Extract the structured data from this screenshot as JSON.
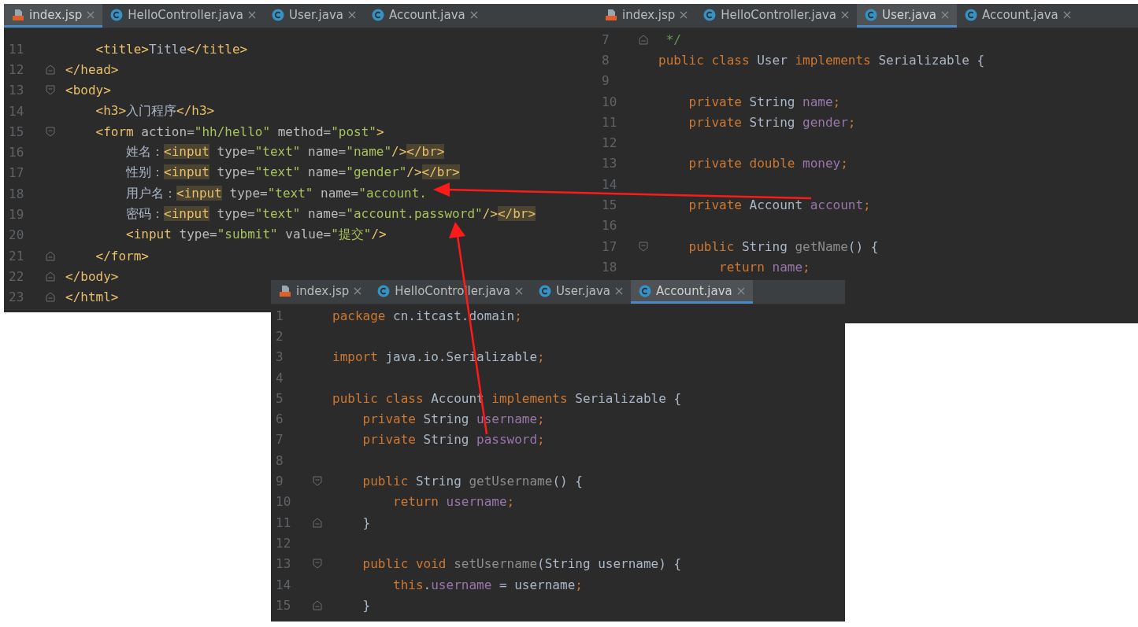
{
  "windows": [
    {
      "tabs": [
        {
          "label": "index.jsp",
          "kind": "jsp",
          "selected": true
        },
        {
          "label": "HelloController.java",
          "kind": "class",
          "selected": false
        },
        {
          "label": "User.java",
          "kind": "class",
          "selected": false
        },
        {
          "label": "Account.java",
          "kind": "class",
          "selected": false
        }
      ],
      "lines": [
        {
          "number": "11",
          "kind": "code",
          "tokens": [
            {
              "text": "    <title>",
              "kind": "tag"
            },
            {
              "text": "Title",
              "kind": "plain"
            },
            {
              "text": "</title>",
              "kind": "tag"
            }
          ]
        },
        {
          "number": "12",
          "kind": "fold-end",
          "tokens": [
            {
              "text": "</head>",
              "kind": "tag"
            }
          ]
        },
        {
          "number": "13",
          "kind": "fold-start",
          "tokens": [
            {
              "text": "<body>",
              "kind": "tag"
            }
          ]
        },
        {
          "number": "14",
          "kind": "code",
          "tokens": [
            {
              "text": "    <h3>",
              "kind": "tag"
            },
            {
              "text": "入门程序",
              "kind": "plain"
            },
            {
              "text": "</h3>",
              "kind": "tag"
            }
          ]
        },
        {
          "number": "15",
          "kind": "fold-start",
          "tokens": [
            {
              "text": "    <form ",
              "kind": "tag"
            },
            {
              "text": "action=",
              "kind": "attr"
            },
            {
              "text": "\"hh/hello\"",
              "kind": "str"
            },
            {
              "text": " method=",
              "kind": "attr"
            },
            {
              "text": "\"post\"",
              "kind": "str"
            },
            {
              "text": ">",
              "kind": "tag"
            }
          ]
        },
        {
          "number": "16",
          "kind": "code",
          "tokens": [
            {
              "text": "        姓名：",
              "kind": "plain"
            },
            {
              "text": "<input",
              "kind": "taghl"
            },
            {
              "text": " type=",
              "kind": "attr"
            },
            {
              "text": "\"text\"",
              "kind": "str"
            },
            {
              "text": " name=",
              "kind": "attr"
            },
            {
              "text": "\"name\"",
              "kind": "str"
            },
            {
              "text": "/>",
              "kind": "tag"
            },
            {
              "text": "</br>",
              "kind": "taghl"
            }
          ]
        },
        {
          "number": "17",
          "kind": "code",
          "tokens": [
            {
              "text": "        性别：",
              "kind": "plain"
            },
            {
              "text": "<input",
              "kind": "taghl"
            },
            {
              "text": " type=",
              "kind": "attr"
            },
            {
              "text": "\"text\"",
              "kind": "str"
            },
            {
              "text": " name=",
              "kind": "attr"
            },
            {
              "text": "\"gender\"",
              "kind": "str"
            },
            {
              "text": "/>",
              "kind": "tag"
            },
            {
              "text": "</br>",
              "kind": "taghl"
            }
          ]
        },
        {
          "number": "18",
          "kind": "code",
          "tokens": [
            {
              "text": "        用户名：",
              "kind": "plain"
            },
            {
              "text": "<input",
              "kind": "taghl"
            },
            {
              "text": " type=",
              "kind": "attr"
            },
            {
              "text": "\"text\"",
              "kind": "str"
            },
            {
              "text": " name=",
              "kind": "attr"
            },
            {
              "text": "\"account.",
              "kind": "str"
            }
          ]
        },
        {
          "number": "19",
          "kind": "code",
          "tokens": [
            {
              "text": "        密码：",
              "kind": "plain"
            },
            {
              "text": "<input",
              "kind": "taghl"
            },
            {
              "text": " type=",
              "kind": "attr"
            },
            {
              "text": "\"text\"",
              "kind": "str"
            },
            {
              "text": " name=",
              "kind": "attr"
            },
            {
              "text": "\"account.password\"",
              "kind": "str"
            },
            {
              "text": "/>",
              "kind": "tag"
            },
            {
              "text": "</br>",
              "kind": "taghl"
            }
          ]
        },
        {
          "number": "20",
          "kind": "code",
          "tokens": [
            {
              "text": "        <input ",
              "kind": "tag"
            },
            {
              "text": "type=",
              "kind": "attr"
            },
            {
              "text": "\"submit\"",
              "kind": "str"
            },
            {
              "text": " value=",
              "kind": "attr"
            },
            {
              "text": "\"提交\"",
              "kind": "str"
            },
            {
              "text": "/>",
              "kind": "tag"
            }
          ]
        },
        {
          "number": "21",
          "kind": "fold-end",
          "tokens": [
            {
              "text": "    </form>",
              "kind": "tag"
            }
          ]
        },
        {
          "number": "22",
          "kind": "fold-end",
          "tokens": [
            {
              "text": "</body>",
              "kind": "tag"
            }
          ]
        },
        {
          "number": "23",
          "kind": "fold-end",
          "tokens": [
            {
              "text": "</html>",
              "kind": "tag"
            }
          ]
        }
      ]
    },
    {
      "tabs": [
        {
          "label": "index.jsp",
          "kind": "jsp",
          "selected": false
        },
        {
          "label": "HelloController.java",
          "kind": "class",
          "selected": false
        },
        {
          "label": "User.java",
          "kind": "class",
          "selected": true
        },
        {
          "label": "Account.java",
          "kind": "class",
          "selected": false
        }
      ],
      "lines": [
        {
          "number": "7",
          "kind": "fold-end",
          "tokens": [
            {
              "text": " */",
              "kind": "comment"
            }
          ]
        },
        {
          "number": "8",
          "kind": "code",
          "tokens": [
            {
              "text": "public class ",
              "kind": "kw"
            },
            {
              "text": "User ",
              "kind": "plain"
            },
            {
              "text": "implements ",
              "kind": "kw"
            },
            {
              "text": "Serializable {",
              "kind": "plain"
            }
          ]
        },
        {
          "number": "9",
          "kind": "code"
        },
        {
          "number": "10",
          "kind": "code",
          "tokens": [
            {
              "text": "    private ",
              "kind": "kw"
            },
            {
              "text": "String ",
              "kind": "plain"
            },
            {
              "text": "name",
              "kind": "field"
            },
            {
              "text": ";",
              "kind": "kw"
            }
          ]
        },
        {
          "number": "11",
          "kind": "code",
          "tokens": [
            {
              "text": "    private ",
              "kind": "kw"
            },
            {
              "text": "String ",
              "kind": "plain"
            },
            {
              "text": "gender",
              "kind": "field"
            },
            {
              "text": ";",
              "kind": "kw"
            }
          ]
        },
        {
          "number": "12",
          "kind": "code"
        },
        {
          "number": "13",
          "kind": "code",
          "tokens": [
            {
              "text": "    private double ",
              "kind": "kw"
            },
            {
              "text": "money",
              "kind": "field"
            },
            {
              "text": ";",
              "kind": "kw"
            }
          ]
        },
        {
          "number": "14",
          "kind": "code"
        },
        {
          "number": "15",
          "kind": "code",
          "tokens": [
            {
              "text": "    private ",
              "kind": "kw"
            },
            {
              "text": "Account ",
              "kind": "plain"
            },
            {
              "text": "account",
              "kind": "field"
            },
            {
              "text": ";",
              "kind": "kw"
            }
          ]
        },
        {
          "number": "16",
          "kind": "code"
        },
        {
          "number": "17",
          "kind": "fold-start",
          "tokens": [
            {
              "text": "    public ",
              "kind": "kw"
            },
            {
              "text": "String ",
              "kind": "plain"
            },
            {
              "text": "getName",
              "kind": "method"
            },
            {
              "text": "() {",
              "kind": "plain"
            }
          ]
        },
        {
          "number": "18",
          "kind": "code",
          "tokens": [
            {
              "text": "        return ",
              "kind": "kw"
            },
            {
              "text": "name",
              "kind": "field"
            },
            {
              "text": ";",
              "kind": "kw"
            }
          ]
        }
      ]
    },
    {
      "tabs": [
        {
          "label": "index.jsp",
          "kind": "jsp",
          "selected": false
        },
        {
          "label": "HelloController.java",
          "kind": "class",
          "selected": false
        },
        {
          "label": "User.java",
          "kind": "class",
          "selected": false
        },
        {
          "label": "Account.java",
          "kind": "class",
          "selected": true
        }
      ],
      "lines": [
        {
          "number": "1",
          "kind": "code",
          "tokens": [
            {
              "text": "package ",
              "kind": "kw"
            },
            {
              "text": "cn.itcast.domain",
              "kind": "plain"
            },
            {
              "text": ";",
              "kind": "kw"
            }
          ]
        },
        {
          "number": "2",
          "kind": "code"
        },
        {
          "number": "3",
          "kind": "code",
          "tokens": [
            {
              "text": "import ",
              "kind": "kw"
            },
            {
              "text": "java.io.Serializable",
              "kind": "plain"
            },
            {
              "text": ";",
              "kind": "kw"
            }
          ]
        },
        {
          "number": "4",
          "kind": "code"
        },
        {
          "number": "5",
          "kind": "code",
          "tokens": [
            {
              "text": "public class ",
              "kind": "kw"
            },
            {
              "text": "Account ",
              "kind": "plain"
            },
            {
              "text": "implements ",
              "kind": "kw"
            },
            {
              "text": "Serializable {",
              "kind": "plain"
            }
          ]
        },
        {
          "number": "6",
          "kind": "code",
          "tokens": [
            {
              "text": "    private ",
              "kind": "kw"
            },
            {
              "text": "String ",
              "kind": "plain"
            },
            {
              "text": "username",
              "kind": "field"
            },
            {
              "text": ";",
              "kind": "kw"
            }
          ]
        },
        {
          "number": "7",
          "kind": "code",
          "tokens": [
            {
              "text": "    private ",
              "kind": "kw"
            },
            {
              "text": "String ",
              "kind": "plain"
            },
            {
              "text": "password",
              "kind": "field"
            },
            {
              "text": ";",
              "kind": "kw"
            }
          ]
        },
        {
          "number": "8",
          "kind": "code"
        },
        {
          "number": "9",
          "kind": "fold-start",
          "tokens": [
            {
              "text": "    public ",
              "kind": "kw"
            },
            {
              "text": "String ",
              "kind": "plain"
            },
            {
              "text": "getUsername",
              "kind": "method"
            },
            {
              "text": "() {",
              "kind": "plain"
            }
          ]
        },
        {
          "number": "10",
          "kind": "code",
          "tokens": [
            {
              "text": "        return ",
              "kind": "kw"
            },
            {
              "text": "username",
              "kind": "field"
            },
            {
              "text": ";",
              "kind": "kw"
            }
          ]
        },
        {
          "number": "11",
          "kind": "fold-end",
          "tokens": [
            {
              "text": "    }",
              "kind": "plain"
            }
          ]
        },
        {
          "number": "12",
          "kind": "code"
        },
        {
          "number": "13",
          "kind": "fold-start",
          "tokens": [
            {
              "text": "    public void ",
              "kind": "kw"
            },
            {
              "text": "setUsername",
              "kind": "method"
            },
            {
              "text": "(String username) {",
              "kind": "plain"
            }
          ]
        },
        {
          "number": "14",
          "kind": "code",
          "tokens": [
            {
              "text": "        this",
              "kind": "kw"
            },
            {
              "text": ".",
              "kind": "plain"
            },
            {
              "text": "username",
              "kind": "field"
            },
            {
              "text": " = username",
              "kind": "plain"
            },
            {
              "text": ";",
              "kind": "kw"
            }
          ]
        },
        {
          "number": "15",
          "kind": "fold-end",
          "tokens": [
            {
              "text": "    }",
              "kind": "plain"
            }
          ]
        }
      ]
    }
  ]
}
